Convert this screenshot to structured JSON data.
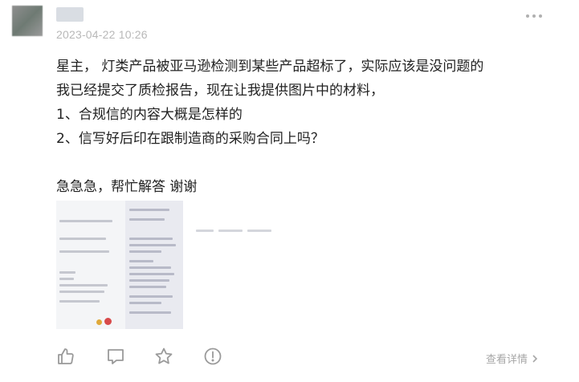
{
  "post": {
    "timestamp": "2023-04-22 10:26",
    "paragraphs": [
      "星主， 灯类产品被亚马逊检测到某些产品超标了，实际应该是没问题的",
      "我已经提交了质检报告，现在让我提供图片中的材料，",
      "1、合规信的内容大概是怎样的",
      "2、信写好后印在跟制造商的采购合同上吗？",
      "",
      "急急急，帮忙解答  谢谢"
    ]
  },
  "footer": {
    "detail_label": "查看详情"
  },
  "icons": {
    "like": "thumbs-up-icon",
    "comment": "comment-icon",
    "favorite": "star-icon",
    "report": "alert-icon",
    "more": "more-dots-icon",
    "detail_arrow": "chevron-right-icon"
  },
  "colors": {
    "icon": "#9a9a9a",
    "meta_text": "#b8b8b8"
  }
}
